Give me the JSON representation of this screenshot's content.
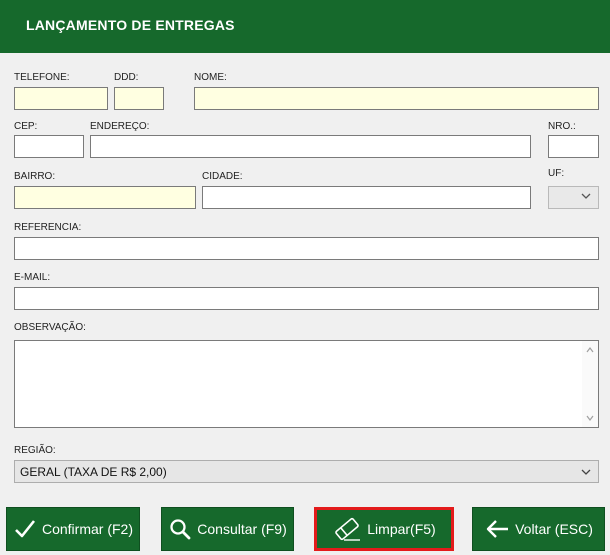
{
  "header": {
    "title": "LANÇAMENTO DE ENTREGAS"
  },
  "form": {
    "telefone_label": "TELEFONE:",
    "ddd_label": "DDD:",
    "nome_label": "NOME:",
    "cep_label": "CEP:",
    "endereco_label": "ENDEREÇO:",
    "nro_label": "NRO.:",
    "bairro_label": "BAIRRO:",
    "cidade_label": "CIDADE:",
    "uf_label": "UF:",
    "referencia_label": "REFERENCIA:",
    "email_label": "E-MAIL:",
    "observacao_label": "OBSERVAÇÃO:",
    "regiao_label": "REGIÃO:",
    "regiao_value": "GERAL (TAXA DE R$ 2,00)"
  },
  "buttons": {
    "confirmar": "Confirmar (F2)",
    "consultar": "Consultar (F9)",
    "limpar": "Limpar(F5)",
    "voltar": "Voltar (ESC)"
  },
  "colors": {
    "header_green": "#16692c",
    "required_field_yellow": "#ffffe1",
    "highlight_red": "#e31b1b"
  },
  "icons": {
    "confirmar": "check-icon",
    "consultar": "search-icon",
    "limpar": "eraser-icon",
    "voltar": "arrow-left-icon"
  }
}
